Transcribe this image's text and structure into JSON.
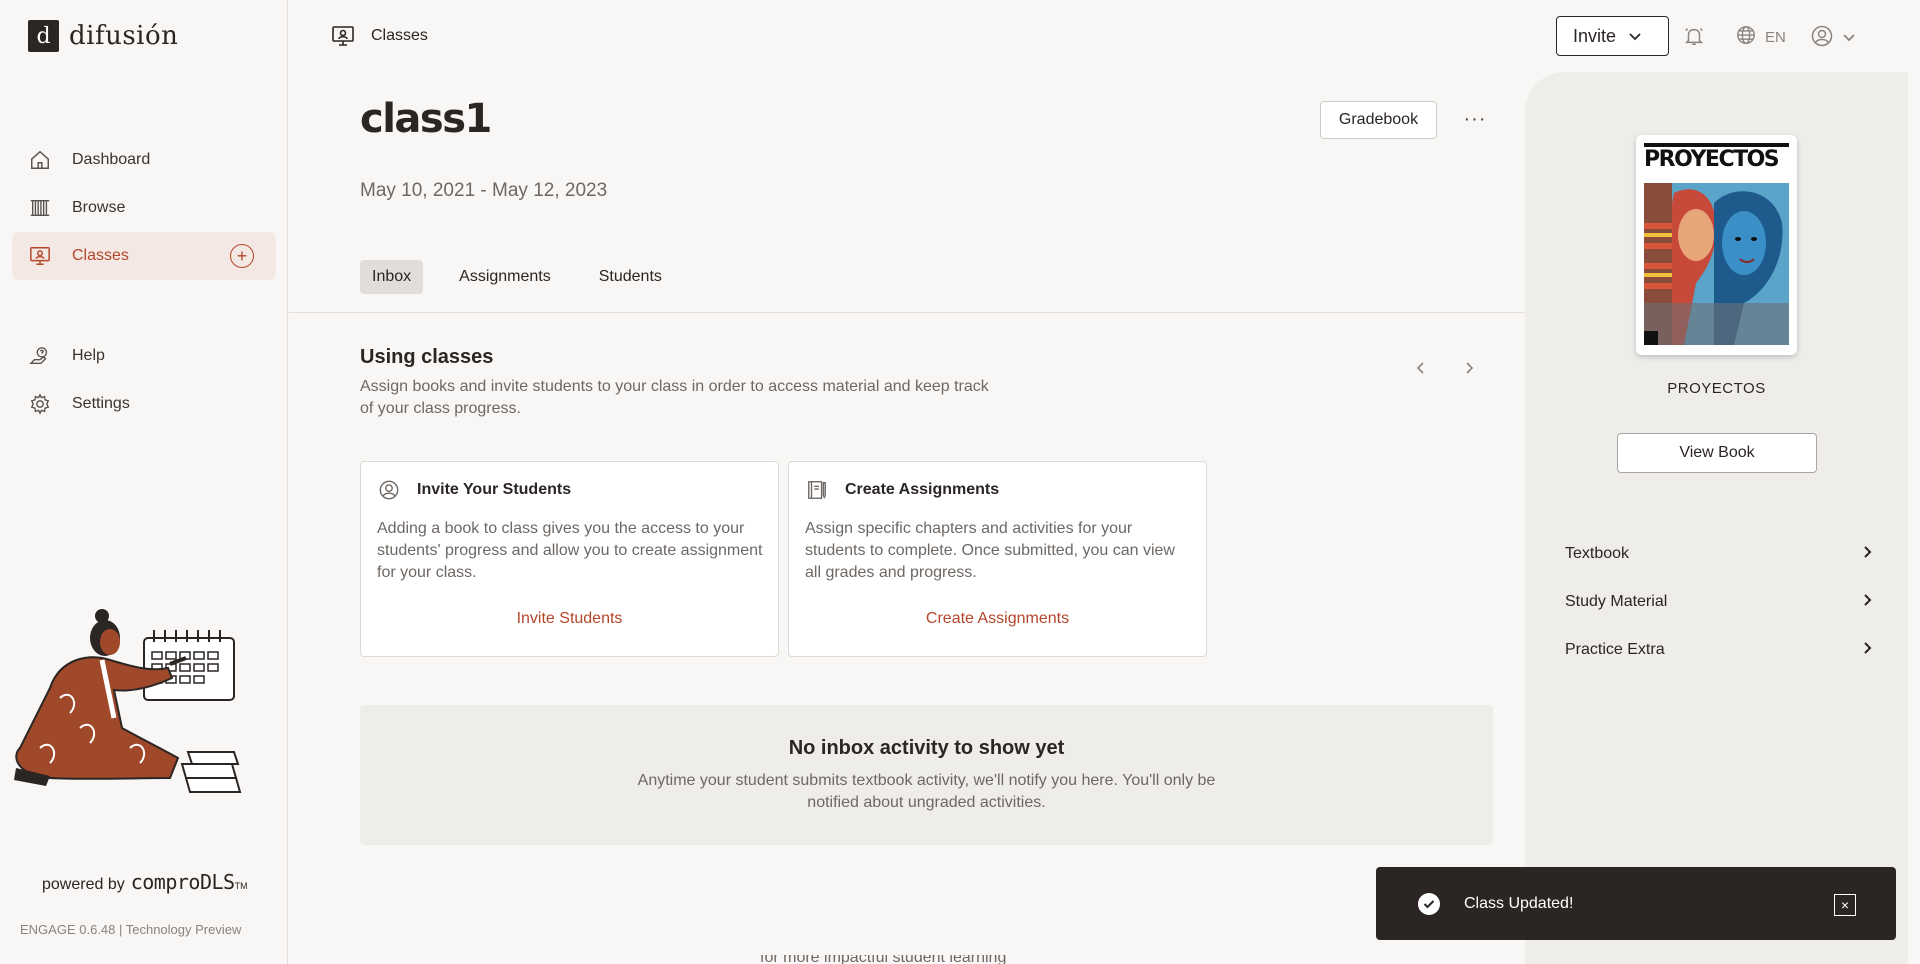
{
  "brand": {
    "logo_letter": "d",
    "name": "difusión"
  },
  "sidebar": {
    "items": [
      {
        "label": "Dashboard",
        "icon": "home-icon"
      },
      {
        "label": "Browse",
        "icon": "bookshelf-icon"
      },
      {
        "label": "Classes",
        "icon": "classroom-icon",
        "active": true
      }
    ],
    "secondary": [
      {
        "label": "Help",
        "icon": "help-icon"
      },
      {
        "label": "Settings",
        "icon": "gear-icon"
      }
    ],
    "powered_by": "powered by",
    "powered_brand": "comproDLS",
    "trademark": "TM",
    "version": "ENGAGE 0.6.48 | Technology Preview"
  },
  "header": {
    "breadcrumb": "Classes",
    "invite_label": "Invite",
    "language": "EN"
  },
  "class": {
    "title": "class1",
    "dates": "May 10, 2021 - May 12, 2023",
    "gradebook_label": "Gradebook",
    "more_label": "···"
  },
  "tabs": [
    {
      "label": "Inbox",
      "active": true
    },
    {
      "label": "Assignments"
    },
    {
      "label": "Students"
    }
  ],
  "using": {
    "title": "Using classes",
    "description": "Assign books and invite students to your class in order to access material and keep track of your class progress."
  },
  "cards": [
    {
      "title": "Invite Your Students",
      "description": "Adding a book to class gives you the access to your students' progress and allow you to create assignment for your class.",
      "link": "Invite Students"
    },
    {
      "title": "Create Assignments",
      "description": "Assign specific chapters and activities for your students to complete. Once submitted, you can view all grades and progress.",
      "link": "Create Assignments"
    }
  ],
  "inbox": {
    "title": "No inbox activity to show yet",
    "description": "Anytime your student submits textbook activity, we'll notify you here. You'll only be notified about ungraded activities."
  },
  "footer_partial": "for more impactful student learning",
  "book": {
    "cover_title": "PROYECTOS",
    "label": "PROYECTOS",
    "view_label": "View Book",
    "sections": [
      "Textbook",
      "Study Material",
      "Practice Extra"
    ]
  },
  "toast": {
    "message": "Class Updated!",
    "close": "×"
  },
  "colors": {
    "accent": "#b4462a",
    "dark": "#2b2523",
    "active_bg": "#f4e8e4"
  }
}
